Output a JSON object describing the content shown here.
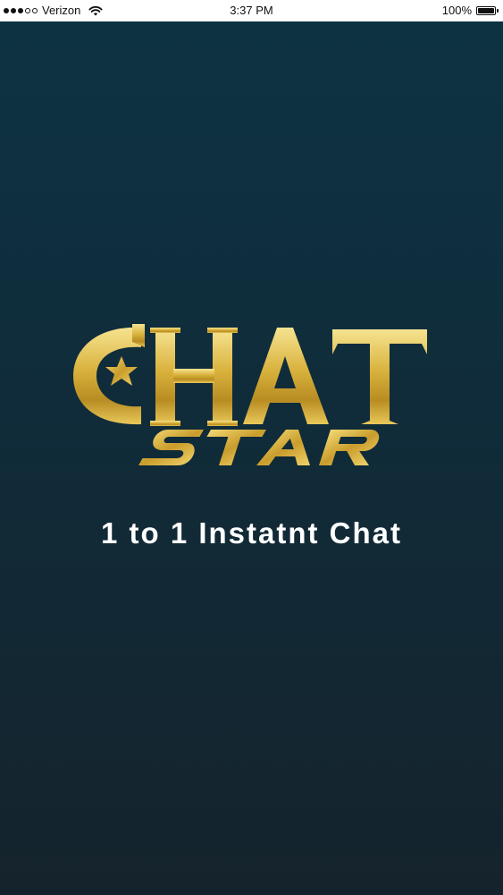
{
  "status_bar": {
    "carrier": "Verizon",
    "time": "3:37 PM",
    "battery": "100%",
    "signal_bars": 3,
    "signal_total": 5
  },
  "logo": {
    "line1": "CHAT",
    "line2": "STAR",
    "colors": {
      "gold_light": "#f4e08a",
      "gold_mid": "#d9b23a",
      "gold_dark": "#8a6a14"
    }
  },
  "tagline": "1 to 1 Instatnt Chat",
  "colors": {
    "background_top": "#0d3343",
    "background_bottom": "#15232c",
    "status_bar_bg": "#ffffff"
  }
}
